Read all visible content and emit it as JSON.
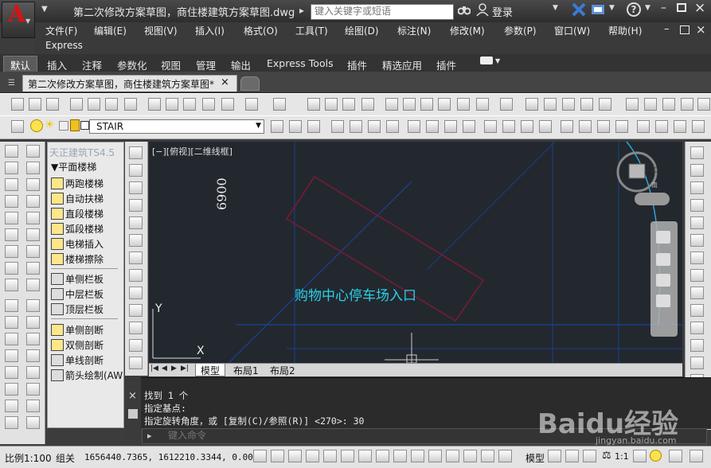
{
  "app": {
    "title": "第二次修改方案草图，商住楼建筑方案草图.dwg",
    "search_placeholder": "键入关键字或短语",
    "login_label": "登录",
    "help_label": "?"
  },
  "menu": {
    "items": [
      "文件(F)",
      "编辑(E)",
      "视图(V)",
      "插入(I)",
      "格式(O)",
      "工具(T)",
      "绘图(D)",
      "标注(N)",
      "修改(M)",
      "参数(P)",
      "窗口(W)",
      "帮助(H)"
    ],
    "second_row": "Express"
  },
  "ribbon_tabs": [
    "默认",
    "插入",
    "注释",
    "参数化",
    "视图",
    "管理",
    "输出",
    "Express Tools",
    "插件",
    "精选应用",
    "插件"
  ],
  "doc_tab": {
    "label": "第二次修改方案草图，商住楼建筑方案草图*",
    "close": "×"
  },
  "layer": {
    "name": "STAIR"
  },
  "tz_panel": {
    "title": "天正建筑TS4.5",
    "section": "▼平面楼梯",
    "items": [
      "两跑楼梯",
      "自动扶梯",
      "直段楼梯",
      "弧段楼梯",
      "电梯插入",
      "楼梯擦除",
      "单侧栏板",
      "中层栏板",
      "顶层栏板",
      "单侧剖断",
      "双侧剖断",
      "单线剖断",
      "箭头绘制(AW"
    ]
  },
  "viewport": {
    "label": "[−][俯视][二维线框]",
    "dim_text": "6900",
    "drawing_text": "购物中心停车场入口",
    "viewcube_top": "上",
    "viewcube_bottom": "南",
    "ucs_y": "Y",
    "ucs_x": "X"
  },
  "layout_tabs": [
    "模型",
    "布局1",
    "布局2"
  ],
  "command": {
    "lines": [
      "找到 1 个",
      "指定基点:",
      "指定旋转角度，或 [复制(C)/参照(R)] <270>: 30"
    ],
    "input_placeholder": "键入命令"
  },
  "status": {
    "scale": "比例1:100",
    "group": "组关",
    "coords": "1656440.7365, 1612210.3344, 0.0000",
    "model_label": "模型",
    "anno_scale": "1:1"
  },
  "watermark": {
    "text": "Baidu经验",
    "sub": "jingyan.baidu.com"
  }
}
